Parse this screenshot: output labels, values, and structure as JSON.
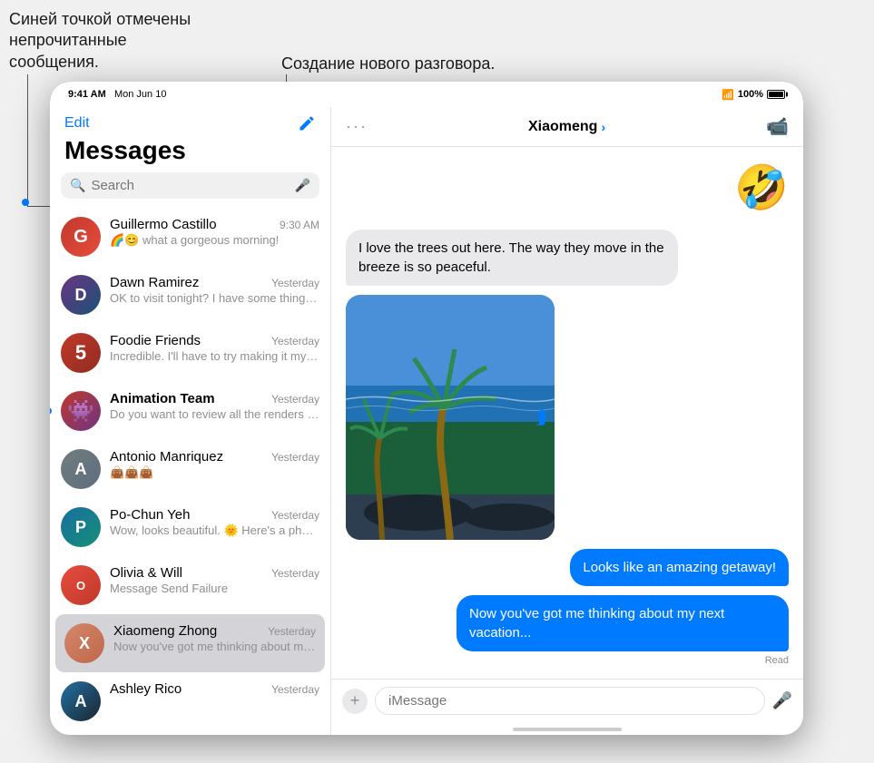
{
  "annotations": {
    "unread_label": "Синей точкой отмечены\nнепрочитанные сообщения.",
    "new_convo_label": "Создание нового разговора."
  },
  "status_bar": {
    "time": "9:41 AM",
    "date": "Mon Jun 10",
    "wifi": "WiFi",
    "battery": "100%"
  },
  "sidebar": {
    "edit_label": "Edit",
    "title": "Messages",
    "search_placeholder": "Search",
    "conversations": [
      {
        "id": "gc",
        "name": "Guillermo Castillo",
        "time": "9:30 AM",
        "preview": "🌈😊 what a gorgeous morning!",
        "avatar_color": "#ff6b35",
        "unread": false,
        "selected": false
      },
      {
        "id": "dr",
        "name": "Dawn Ramirez",
        "time": "Yesterday",
        "preview": "OK to visit tonight? I have some things I need the grandkids' help...",
        "avatar_color": "#8e44ad",
        "unread": false,
        "selected": false
      },
      {
        "id": "ff",
        "name": "Foodie Friends",
        "time": "Yesterday",
        "preview": "Incredible. I'll have to try making it myself.",
        "avatar_color": "#e74c3c",
        "unread": false,
        "selected": false
      },
      {
        "id": "at",
        "name": "Animation Team",
        "time": "Yesterday",
        "preview": "Do you want to review all the renders together next time we me...",
        "avatar_color": "#e74c3c",
        "unread": true,
        "selected": false
      },
      {
        "id": "am",
        "name": "Antonio Manriquez",
        "time": "Yesterday",
        "preview": "👜👜👜",
        "avatar_color": "#95a5a6",
        "unread": false,
        "selected": false
      },
      {
        "id": "py",
        "name": "Po-Chun Yeh",
        "time": "Yesterday",
        "preview": "Wow, looks beautiful. 🌞 Here's a photo of the beach!",
        "avatar_color": "#2980b9",
        "unread": false,
        "selected": false
      },
      {
        "id": "ow",
        "name": "Olivia & Will",
        "time": "Yesterday",
        "preview": "Message Send Failure",
        "avatar_color": "#e74c3c",
        "unread": false,
        "selected": false
      },
      {
        "id": "xz",
        "name": "Xiaomeng Zhong",
        "time": "Yesterday",
        "preview": "Now you've got me thinking about my next vacation...",
        "avatar_color": "#e8a87c",
        "unread": false,
        "selected": true
      },
      {
        "id": "ar",
        "name": "Ashley Rico",
        "time": "Yesterday",
        "preview": "",
        "avatar_color": "#3498db",
        "unread": false,
        "selected": false
      }
    ]
  },
  "chat": {
    "contact_name": "Xiaomeng",
    "messages": [
      {
        "type": "received",
        "text": "I love the trees out here. The way they move in the breeze is so peaceful.",
        "has_image": true
      },
      {
        "type": "sent",
        "text": "Looks like an amazing getaway!"
      },
      {
        "type": "sent",
        "text": "Now you've got me thinking about my next vacation..."
      }
    ],
    "read_label": "Read",
    "input_placeholder": "iMessage",
    "emoji_reaction": "🤣"
  }
}
